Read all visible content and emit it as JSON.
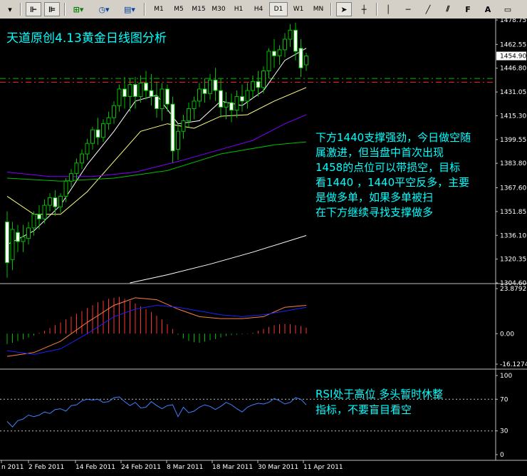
{
  "toolbar": {
    "timeframes": [
      "M1",
      "M5",
      "M15",
      "M30",
      "H1",
      "H4",
      "D1",
      "W1",
      "MN"
    ],
    "active_timeframe": "D1",
    "letters": [
      "A"
    ]
  },
  "annotations": {
    "title": "天道原创4.13黄金日线图分析",
    "analysis_lines": [
      "下方1440支撑强劲，今日做空随",
      "属激进，但当盘中首次出现",
      "1458的点位可以带损空，目标",
      "看1440 ，1440平空反多，主要",
      "是做多单，如果多单被扫",
      "在下方继续寻找支撑做多"
    ],
    "rsi_lines": [
      "RSI处于高位 多头暂时休整",
      "指标，不要盲目看空"
    ]
  },
  "colors": {
    "background": "#000000",
    "grid": "#c0c0c0",
    "bull_candle": "#000000",
    "bear_candle": "#ffffff",
    "candle_outline": "#00c000",
    "ma_fast": "#ffffff",
    "ma_mid": "#ffff80",
    "ma_violet": "#8000ff",
    "ma_green": "#00c000",
    "ma_slow": "#ffffff",
    "macd_pos": "#ff3030",
    "macd_neg": "#00c000",
    "macd_line1": "#ff8040",
    "macd_line2": "#2020ff",
    "rsi_line": "#4080ff",
    "rsi_levels": "#c0c0c0",
    "annotation_text": "#00ffff",
    "support_line_green": "#00c000",
    "support_line_red": "#ff2020",
    "price_label_bg": "#ffffff"
  },
  "chart_data": [
    {
      "type": "candlestick",
      "pane": "price",
      "instrument": "Gold (XAUUSD)",
      "timeframe": "D1",
      "ylim": [
        1304.6,
        1478.75
      ],
      "yticks": [
        1478.75,
        1462.55,
        1446.8,
        1431.05,
        1415.3,
        1399.55,
        1383.8,
        1367.6,
        1351.85,
        1336.1,
        1320.35,
        1304.6
      ],
      "current_price": 1454.9,
      "x_labels": [
        "n 2011",
        "2 Feb 2011",
        "14 Feb 2011",
        "24 Feb 2011",
        "8 Mar 2011",
        "18 Mar 2011",
        "30 Mar 2011",
        "11 Apr 2011"
      ],
      "horizontal_levels": [
        1440.0,
        1437.5
      ],
      "candles": [
        {
          "o": 1345,
          "h": 1352,
          "c": 1318,
          "l": 1308
        },
        {
          "o": 1320,
          "h": 1345,
          "c": 1340,
          "l": 1313
        },
        {
          "o": 1338,
          "h": 1343,
          "c": 1332,
          "l": 1325
        },
        {
          "o": 1332,
          "h": 1343,
          "c": 1335,
          "l": 1325
        },
        {
          "o": 1334,
          "h": 1345,
          "c": 1341,
          "l": 1330
        },
        {
          "o": 1341,
          "h": 1352,
          "c": 1350,
          "l": 1336
        },
        {
          "o": 1350,
          "h": 1356,
          "c": 1347,
          "l": 1340
        },
        {
          "o": 1347,
          "h": 1360,
          "c": 1356,
          "l": 1344
        },
        {
          "o": 1356,
          "h": 1364,
          "c": 1361,
          "l": 1352
        },
        {
          "o": 1361,
          "h": 1366,
          "c": 1355,
          "l": 1349
        },
        {
          "o": 1355,
          "h": 1364,
          "c": 1362,
          "l": 1351
        },
        {
          "o": 1362,
          "h": 1374,
          "c": 1372,
          "l": 1358
        },
        {
          "o": 1372,
          "h": 1380,
          "c": 1377,
          "l": 1368
        },
        {
          "o": 1377,
          "h": 1387,
          "c": 1384,
          "l": 1373
        },
        {
          "o": 1384,
          "h": 1393,
          "c": 1390,
          "l": 1380
        },
        {
          "o": 1390,
          "h": 1400,
          "c": 1397,
          "l": 1386
        },
        {
          "o": 1397,
          "h": 1408,
          "c": 1406,
          "l": 1393
        },
        {
          "o": 1406,
          "h": 1414,
          "c": 1401,
          "l": 1396
        },
        {
          "o": 1401,
          "h": 1413,
          "c": 1410,
          "l": 1398
        },
        {
          "o": 1410,
          "h": 1418,
          "c": 1414,
          "l": 1406
        },
        {
          "o": 1414,
          "h": 1425,
          "c": 1422,
          "l": 1410
        },
        {
          "o": 1422,
          "h": 1436,
          "c": 1433,
          "l": 1418
        },
        {
          "o": 1433,
          "h": 1441,
          "c": 1428,
          "l": 1420
        },
        {
          "o": 1428,
          "h": 1440,
          "c": 1436,
          "l": 1418
        },
        {
          "o": 1436,
          "h": 1441,
          "c": 1428,
          "l": 1420
        },
        {
          "o": 1428,
          "h": 1442,
          "c": 1437,
          "l": 1424
        },
        {
          "o": 1437,
          "h": 1445,
          "c": 1432,
          "l": 1426
        },
        {
          "o": 1432,
          "h": 1443,
          "c": 1428,
          "l": 1422
        },
        {
          "o": 1428,
          "h": 1438,
          "c": 1420,
          "l": 1414
        },
        {
          "o": 1420,
          "h": 1437,
          "c": 1433,
          "l": 1412
        },
        {
          "o": 1433,
          "h": 1436,
          "c": 1423,
          "l": 1418
        },
        {
          "o": 1423,
          "h": 1428,
          "c": 1392,
          "l": 1384
        },
        {
          "o": 1393,
          "h": 1410,
          "c": 1405,
          "l": 1386
        },
        {
          "o": 1405,
          "h": 1416,
          "c": 1412,
          "l": 1400
        },
        {
          "o": 1412,
          "h": 1424,
          "c": 1420,
          "l": 1408
        },
        {
          "o": 1420,
          "h": 1428,
          "c": 1425,
          "l": 1413
        },
        {
          "o": 1425,
          "h": 1437,
          "c": 1433,
          "l": 1421
        },
        {
          "o": 1433,
          "h": 1440,
          "c": 1430,
          "l": 1424
        },
        {
          "o": 1430,
          "h": 1443,
          "c": 1439,
          "l": 1426
        },
        {
          "o": 1439,
          "h": 1447,
          "c": 1432,
          "l": 1425
        },
        {
          "o": 1432,
          "h": 1440,
          "c": 1421,
          "l": 1414
        },
        {
          "o": 1421,
          "h": 1431,
          "c": 1424,
          "l": 1413
        },
        {
          "o": 1424,
          "h": 1430,
          "c": 1419,
          "l": 1411
        },
        {
          "o": 1419,
          "h": 1432,
          "c": 1428,
          "l": 1414
        },
        {
          "o": 1428,
          "h": 1436,
          "c": 1425,
          "l": 1418
        },
        {
          "o": 1425,
          "h": 1437,
          "c": 1432,
          "l": 1420
        },
        {
          "o": 1432,
          "h": 1442,
          "c": 1438,
          "l": 1427
        },
        {
          "o": 1438,
          "h": 1445,
          "c": 1434,
          "l": 1428
        },
        {
          "o": 1434,
          "h": 1448,
          "c": 1445,
          "l": 1430
        },
        {
          "o": 1445,
          "h": 1460,
          "c": 1458,
          "l": 1440
        },
        {
          "o": 1458,
          "h": 1466,
          "c": 1455,
          "l": 1447
        },
        {
          "o": 1455,
          "h": 1462,
          "c": 1459,
          "l": 1449
        },
        {
          "o": 1459,
          "h": 1470,
          "c": 1466,
          "l": 1454
        },
        {
          "o": 1466,
          "h": 1476,
          "c": 1472,
          "l": 1461
        },
        {
          "o": 1472,
          "h": 1477,
          "c": 1458,
          "l": 1452
        },
        {
          "o": 1460,
          "h": 1466,
          "c": 1447,
          "l": 1441
        },
        {
          "o": 1449,
          "h": 1457,
          "c": 1454.9,
          "l": 1445
        }
      ],
      "moving_averages": [
        {
          "color": "#ffffff",
          "values": [
            [
              0,
              1330
            ],
            [
              5,
              1339
            ],
            [
              10,
              1356
            ],
            [
              15,
              1383
            ],
            [
              20,
              1405
            ],
            [
              24,
              1425
            ],
            [
              28,
              1429
            ],
            [
              32,
              1410
            ],
            [
              36,
              1412
            ],
            [
              40,
              1425
            ],
            [
              44,
              1422
            ],
            [
              48,
              1432
            ],
            [
              52,
              1452
            ],
            [
              56,
              1460
            ]
          ]
        },
        {
          "color": "#ffff80",
          "values": [
            [
              0,
              1362
            ],
            [
              5,
              1350
            ],
            [
              10,
              1350
            ],
            [
              15,
              1365
            ],
            [
              20,
              1385
            ],
            [
              25,
              1405
            ],
            [
              30,
              1410
            ],
            [
              35,
              1407
            ],
            [
              40,
              1415
            ],
            [
              45,
              1416
            ],
            [
              50,
              1425
            ],
            [
              56,
              1434
            ]
          ]
        },
        {
          "color": "#8000ff",
          "values": [
            [
              0,
              1378
            ],
            [
              8,
              1375
            ],
            [
              16,
              1375
            ],
            [
              24,
              1378
            ],
            [
              32,
              1385
            ],
            [
              40,
              1393
            ],
            [
              46,
              1399
            ],
            [
              52,
              1410
            ],
            [
              56,
              1416
            ]
          ]
        },
        {
          "color": "#00c000",
          "values": [
            [
              0,
              1374
            ],
            [
              10,
              1372
            ],
            [
              20,
              1374
            ],
            [
              30,
              1379
            ],
            [
              40,
              1390
            ],
            [
              50,
              1396
            ],
            [
              56,
              1398
            ]
          ]
        },
        {
          "color": "#ffffff",
          "values": [
            [
              23,
              1304.6
            ],
            [
              30,
              1310
            ],
            [
              38,
              1317
            ],
            [
              46,
              1325
            ],
            [
              56,
              1336
            ]
          ]
        }
      ]
    },
    {
      "type": "bar",
      "pane": "macd",
      "ylim": [
        -16.1274,
        23.8792
      ],
      "yticks": [
        23.8792,
        0.0,
        -16.1274
      ],
      "histogram": [
        -5.5,
        -4.8,
        -3.8,
        -3.0,
        -2.0,
        -1.0,
        0.5,
        1.5,
        3.0,
        4.5,
        6.0,
        7.5,
        9.0,
        10.5,
        12.0,
        13.5,
        15.0,
        16.5,
        17.5,
        18.5,
        19.0,
        19.5,
        18.5,
        17.5,
        16.0,
        14.5,
        13.0,
        11.5,
        9.5,
        7.5,
        5.0,
        2.5,
        -0.5,
        -2.5,
        -3.8,
        -4.5,
        -4.8,
        -4.2,
        -3.5,
        -2.8,
        -2.0,
        -1.2,
        -0.8,
        -0.5,
        -0.3,
        -0.2,
        0.5,
        1.5,
        2.5,
        3.5,
        4.5,
        5.0,
        5.2,
        5.0,
        4.5,
        4.0,
        3.2
      ],
      "lines": [
        {
          "name": "signal",
          "color": "#ff8040",
          "values": [
            [
              0,
              -12
            ],
            [
              5,
              -10
            ],
            [
              10,
              -4
            ],
            [
              15,
              6
            ],
            [
              20,
              15
            ],
            [
              24,
              19
            ],
            [
              28,
              18
            ],
            [
              32,
              13
            ],
            [
              36,
              9
            ],
            [
              40,
              8
            ],
            [
              44,
              8
            ],
            [
              48,
              9
            ],
            [
              52,
              14
            ],
            [
              56,
              15
            ]
          ]
        },
        {
          "name": "macd",
          "color": "#2020ff",
          "values": [
            [
              0,
              -9
            ],
            [
              5,
              -11
            ],
            [
              10,
              -8
            ],
            [
              15,
              0
            ],
            [
              20,
              9
            ],
            [
              24,
              13
            ],
            [
              28,
              15
            ],
            [
              32,
              14
            ],
            [
              36,
              12
            ],
            [
              40,
              10
            ],
            [
              44,
              9
            ],
            [
              48,
              10
            ],
            [
              52,
              12
            ],
            [
              56,
              14
            ]
          ]
        }
      ]
    },
    {
      "type": "line",
      "pane": "rsi",
      "ylim": [
        0,
        100
      ],
      "yticks": [
        100,
        70,
        30,
        0
      ],
      "levels": [
        70,
        30
      ],
      "values": [
        42,
        35,
        43,
        45,
        50,
        48,
        50,
        54,
        52,
        57,
        58,
        55,
        62,
        63,
        68,
        70,
        69,
        70,
        66,
        67,
        72,
        73,
        67,
        62,
        66,
        59,
        60,
        67,
        62,
        58,
        62,
        63,
        48,
        60,
        53,
        55,
        60,
        63,
        61,
        57,
        61,
        66,
        63,
        58,
        54,
        60,
        63,
        65,
        64,
        66,
        71,
        68,
        64,
        66,
        72,
        70,
        63
      ]
    }
  ]
}
